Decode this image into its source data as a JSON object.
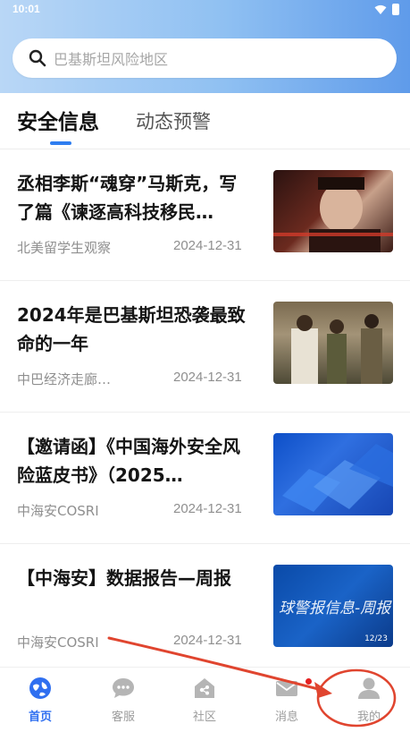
{
  "status_bar": {
    "time": "10:01"
  },
  "search": {
    "placeholder": "巴基斯坦风险地区"
  },
  "tabs": [
    {
      "label": "安全信息",
      "active": true
    },
    {
      "label": "动态预警",
      "active": false
    }
  ],
  "news": [
    {
      "title": "丞相李斯“魂穿”马斯克，写了篇《谏逐高科技移民…",
      "source": "北美留学生观察",
      "date": "2024-12-31"
    },
    {
      "title": "2024年是巴基斯坦恐袭最致命的一年",
      "source": "中巴经济走廊…",
      "date": "2024-12-31"
    },
    {
      "title": "【邀请函】《中国海外安全风险蓝皮书》（2025…",
      "source": "中海安COSRI",
      "date": "2024-12-31"
    },
    {
      "title": "【中海安】数据报告—周报",
      "source": "中海安COSRI",
      "date": "2024-12-31",
      "thumb_text": "球警报信息-周报",
      "thumb_small": "12/23"
    }
  ],
  "bottom_nav": [
    {
      "label": "首页",
      "icon": "globe-icon",
      "active": true
    },
    {
      "label": "客服",
      "icon": "chat-icon",
      "active": false
    },
    {
      "label": "社区",
      "icon": "community-icon",
      "active": false
    },
    {
      "label": "消息",
      "icon": "mail-icon",
      "active": false,
      "badge": true
    },
    {
      "label": "我的",
      "icon": "user-icon",
      "active": false
    }
  ],
  "colors": {
    "accent": "#2f6ff0",
    "header_gradient_start": "#b9d7f6",
    "header_gradient_end": "#5f9bea",
    "annotation": "#e0452f",
    "badge": "#e62020"
  }
}
